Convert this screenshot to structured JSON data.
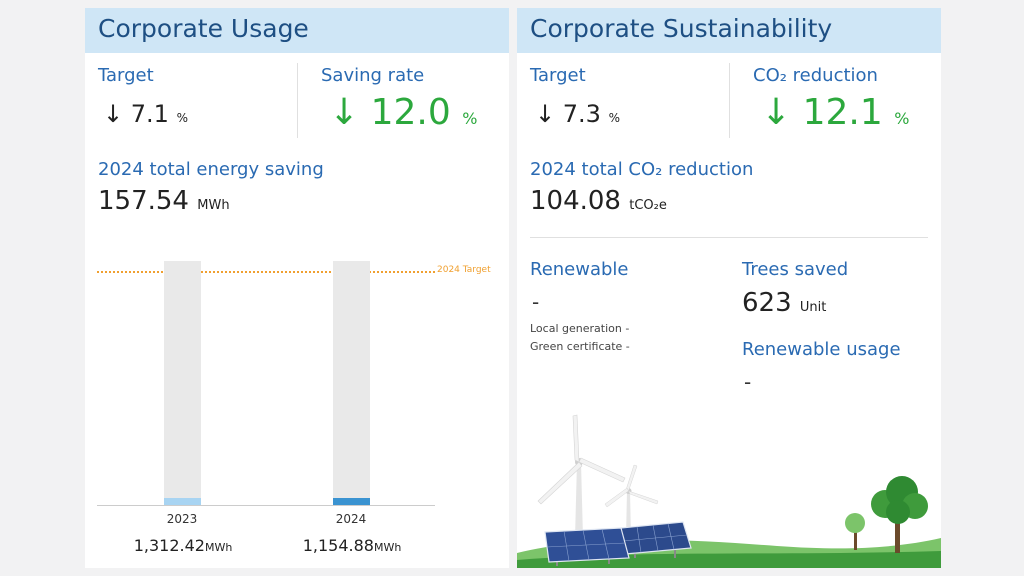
{
  "usage": {
    "title": "Corporate Usage",
    "target_label": "Target",
    "target_arrow": "↓",
    "target_value": "7.1",
    "target_unit": "%",
    "saving_label": "Saving rate",
    "saving_arrow": "↓",
    "saving_value": "12.0",
    "saving_unit": "%",
    "total_label": "2024 total energy saving",
    "total_value": "157.54",
    "total_unit": "MWh",
    "target_line_label": "2024 Target",
    "bars": [
      {
        "year": "2023",
        "value": "1,312.42",
        "unit": "MWh",
        "fill_fraction": 0.03,
        "color": "#a8d4f2"
      },
      {
        "year": "2024",
        "value": "1,154.88",
        "unit": "MWh",
        "fill_fraction": 0.03,
        "color": "#3a93d1"
      }
    ]
  },
  "sustainability": {
    "title": "Corporate Sustainability",
    "target_label": "Target",
    "target_arrow": "↓",
    "target_value": "7.3",
    "target_unit": "%",
    "co2_label": "CO₂ reduction",
    "co2_arrow": "↓",
    "co2_value": "12.1",
    "co2_unit": "%",
    "total_label": "2024 total CO₂ reduction",
    "total_value": "104.08",
    "total_unit": "tCO₂e",
    "renewable_label": "Renewable",
    "renewable_value": "-",
    "local_generation": "Local generation  -",
    "green_certificate": "Green certificate  -",
    "trees_label": "Trees saved",
    "trees_value": "623",
    "trees_unit": "Unit",
    "renewable_usage_label": "Renewable usage",
    "renewable_usage_value": "-"
  },
  "colors": {
    "header_bg": "#cfe6f6",
    "header_text": "#1e4f83",
    "label_blue": "#2a6ab2",
    "green": "#2ca83d",
    "target_line": "#f0a030"
  }
}
